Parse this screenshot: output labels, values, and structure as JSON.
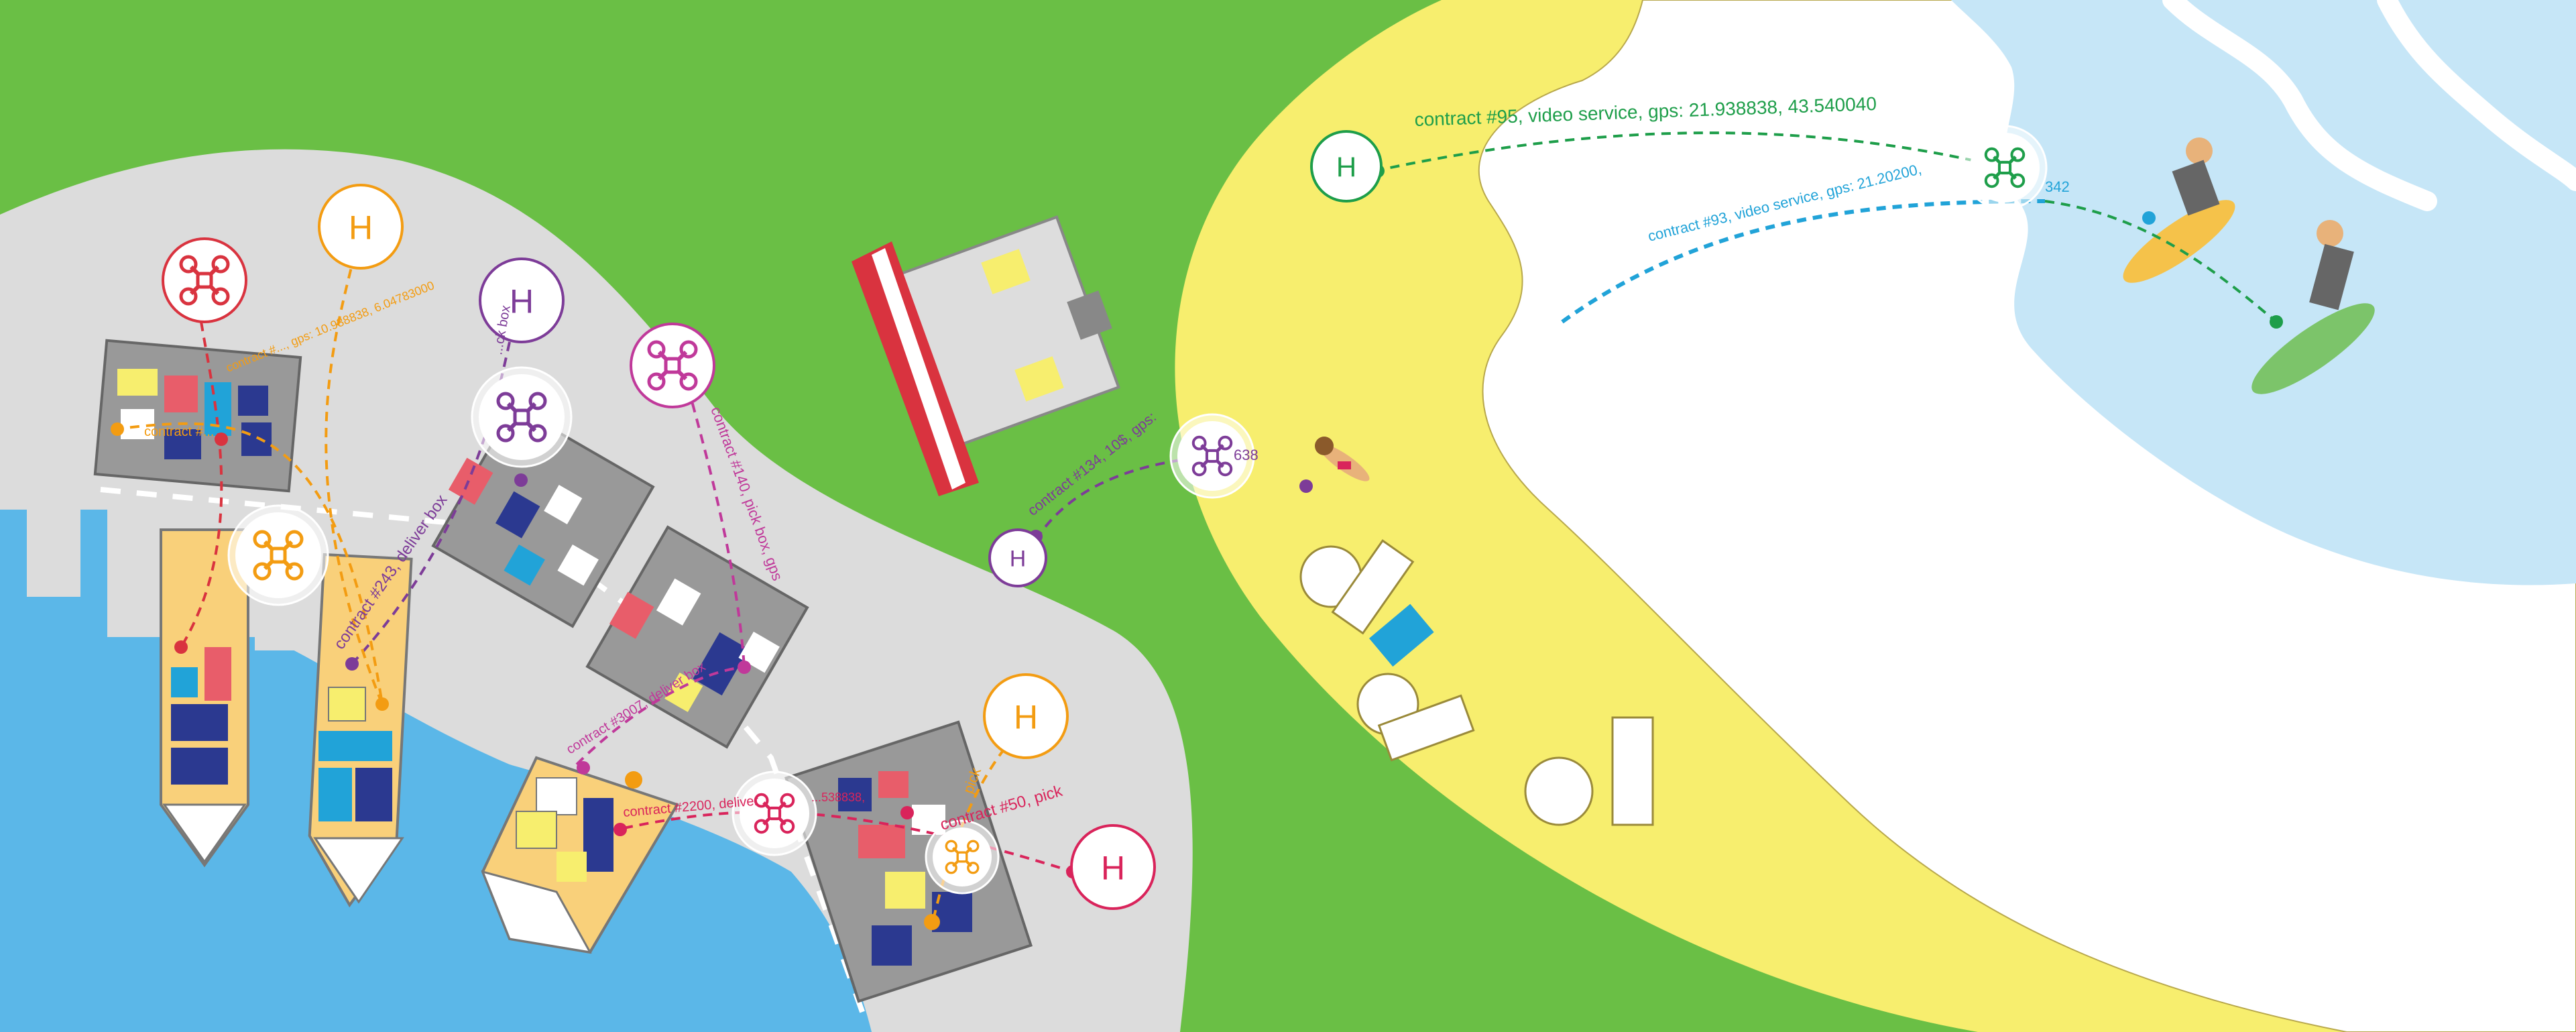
{
  "colors": {
    "grass": "#6abf45",
    "beach": "#f7ee6e",
    "sea": "#5bb7e8",
    "surf_water": "#c6e6f7",
    "foam": "#ffffff",
    "pavement": "#dcdcdc",
    "orange": "#f39c12",
    "red": "#d9333f",
    "purple": "#7d3c98",
    "magenta": "#c0399a",
    "green": "#1e9e4a",
    "cyan": "#21a3d8",
    "crimson": "#d9245b"
  },
  "hubs": [
    {
      "id": "hub-orange-top",
      "letter": "H",
      "color": "orange"
    },
    {
      "id": "hub-purple-top",
      "letter": "H",
      "color": "purple"
    },
    {
      "id": "hub-orange-right",
      "letter": "H",
      "color": "orange"
    },
    {
      "id": "hub-crimson",
      "letter": "H",
      "color": "crimson"
    },
    {
      "id": "hub-purple-center",
      "letter": "H",
      "color": "purple"
    },
    {
      "id": "hub-green-beach",
      "letter": "H",
      "color": "green"
    }
  ],
  "contracts": [
    {
      "id": "c95",
      "text": "contract #95, video service, gps: 21.938838, 43.540040",
      "color": "green"
    },
    {
      "id": "c93",
      "text": "contract #93, video service, gps: 21.20200,",
      "suffix": "342",
      "color": "cyan"
    },
    {
      "id": "c134",
      "text": "contract #134, 10$, gps:",
      "suffix": "638",
      "color": "purple"
    },
    {
      "id": "c243",
      "text": "contract #243, deliver box",
      "color": "purple"
    },
    {
      "id": "c140",
      "text": "contract #140, pick box, gps",
      "color": "magenta"
    },
    {
      "id": "c50",
      "text": "contract #50, pick",
      "color": "crimson"
    },
    {
      "id": "c2200",
      "text": "contract #2200, deliver",
      "color": "crimson"
    },
    {
      "id": "c3007",
      "text": "contract #3007, deliver box",
      "color": "magenta"
    },
    {
      "id": "c_orange_gps",
      "text": "contract #..., gps: 10.938838, 6.04783000",
      "color": "orange"
    },
    {
      "id": "c_orange_small",
      "text": "contract #...",
      "color": "orange"
    },
    {
      "id": "c_crimson_gps",
      "text": "...538838,",
      "color": "crimson"
    },
    {
      "id": "c_pick_box",
      "text": "...ck box",
      "color": "purple"
    },
    {
      "id": "c_pick_vert",
      "text": "pick",
      "color": "orange"
    }
  ]
}
